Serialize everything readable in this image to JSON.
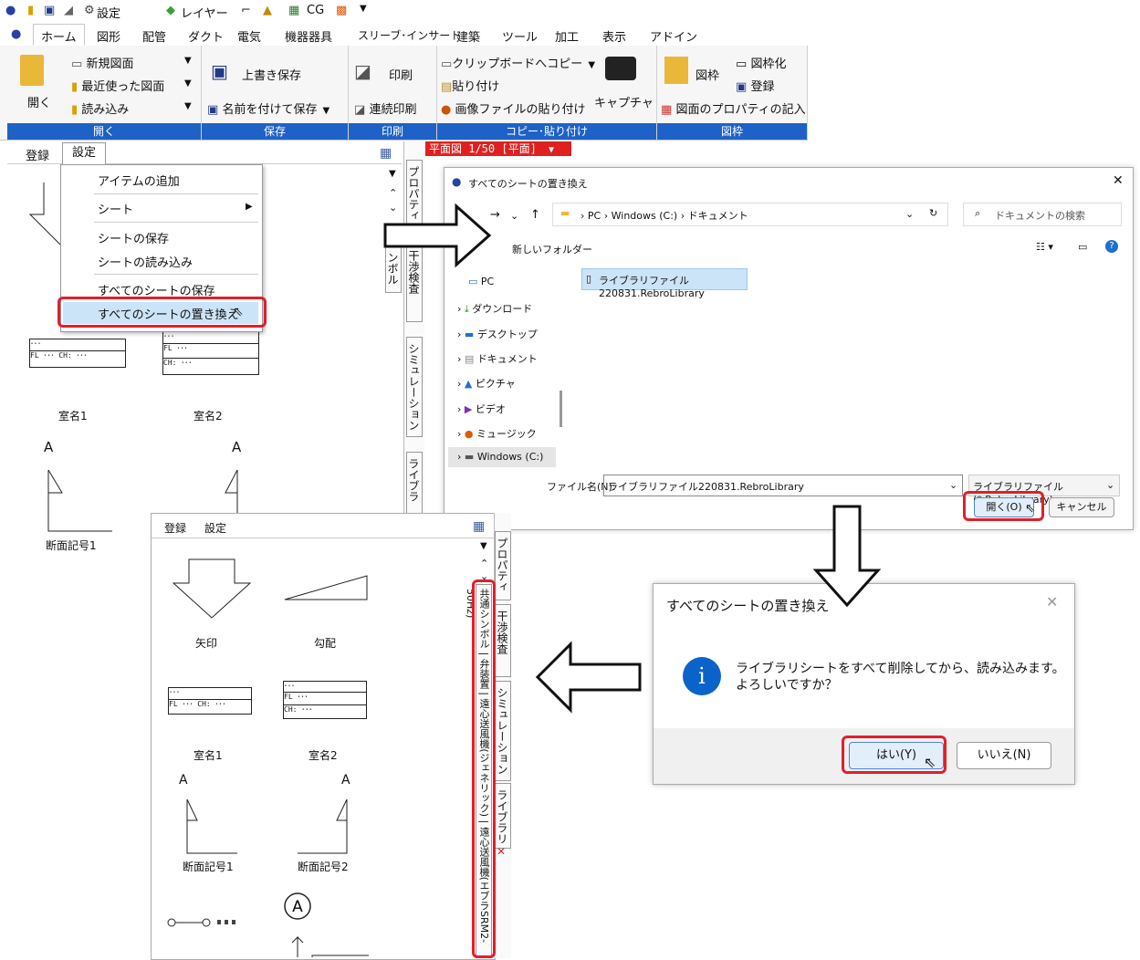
{
  "qa": {
    "settings": "設定",
    "layer": "レイヤー",
    "cg": "CG"
  },
  "tabs": [
    "ホーム",
    "図形",
    "配管",
    "ダクト",
    "電気",
    "機器器具",
    "スリーブ･インサート",
    "建築",
    "ツール",
    "加工",
    "表示",
    "アドイン"
  ],
  "ribbon": {
    "open_group": {
      "label": "開く",
      "open": "開く",
      "new": "新規図面",
      "recent": "最近使った図面",
      "load": "読み込み"
    },
    "save_group": {
      "label": "保存",
      "overwrite": "上書き保存",
      "saveas": "名前を付けて保存"
    },
    "print_group": {
      "label": "印刷",
      "print": "印刷",
      "continuous": "連続印刷"
    },
    "copy_group": {
      "label": "コピー･貼り付け",
      "copy": "クリップボードへコピー",
      "paste": "貼り付け",
      "paste_image": "画像ファイルの貼り付け",
      "capture": "キャプチャ"
    },
    "frame_group": {
      "label": "図枠",
      "frame": "図枠",
      "frameize": "図枠化",
      "register": "登録",
      "props": "図面のプロパティの記入"
    }
  },
  "panel1": {
    "tab_register": "登録",
    "tab_settings": "設定",
    "view_tab": "平面図 1/50 [平面]",
    "side": [
      "プロパティ",
      "干渉検査",
      "シミュレーション",
      "ライブラ"
    ],
    "side_partial": "ンボル"
  },
  "menu": {
    "add": "アイテムの追加",
    "sheet": "シート",
    "save_sheet": "シートの保存",
    "load_sheet": "シートの読み込み",
    "save_all": "すべてのシートの保存",
    "replace_all": "すべてのシートの置き換え"
  },
  "symbols": {
    "room1": "室名1",
    "room2": "室名2",
    "section1": "断面記号1",
    "section2": "断面記号2",
    "arrow": "矢印",
    "slope": "勾配",
    "a": "A",
    "fl": "FL ･･･",
    "ch": "CH: ･･･",
    "dots": "･･･"
  },
  "file_dialog": {
    "title": "すべてのシートの置き換え",
    "path": [
      "PC",
      "Windows (C:)",
      "ドキュメント"
    ],
    "search_placeholder": "ドキュメントの検索",
    "new_folder": "新しいフォルダー",
    "tree": [
      "PC",
      "ダウンロード",
      "デスクトップ",
      "ドキュメント",
      "ピクチャ",
      "ビデオ",
      "ミュージック",
      "Windows (C:)"
    ],
    "file": "ライブラリファイル220831.RebroLibrary",
    "filename_label": "ファイル名(N):",
    "filename": "ライブラリファイル220831.RebroLibrary",
    "filter": "ライブラリファイル(*.RebroLibrary)",
    "open": "開く(O)",
    "cancel": "キャンセル"
  },
  "confirm": {
    "title": "すべてのシートの置き換え",
    "msg1": "ライブラリシートをすべて削除してから、読み込みます。",
    "msg2": "よろしいですか？",
    "yes": "はい(Y)",
    "no": "いいえ(N)"
  },
  "panel2": {
    "tab_register": "登録",
    "tab_settings": "設定",
    "side": [
      "プロパティ",
      "干渉検査",
      "シミュレーション",
      "ライブラリ"
    ],
    "sheets": "共通シンボル | 弁装置 | 遠心送風機(ジェネリック) | 遠心送風機(エブラSRM2-50Hz)"
  },
  "colors": {
    "accent": "#1e62c7",
    "highlight": "#e0202a",
    "info": "#0a63c9"
  }
}
